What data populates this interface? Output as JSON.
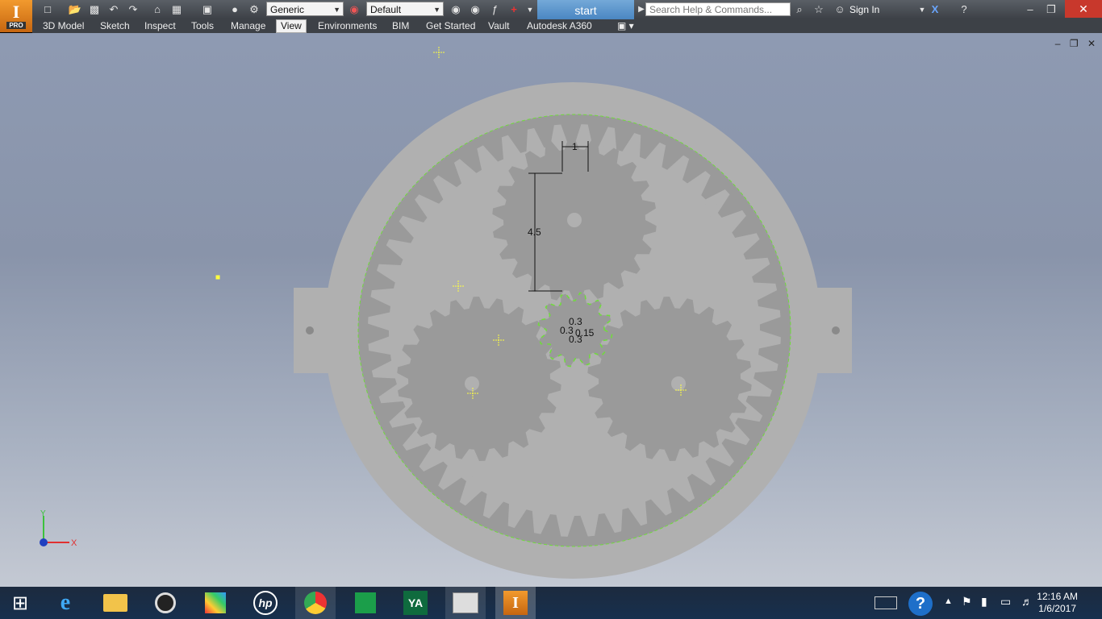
{
  "app": {
    "logo_text": "I",
    "logo_badge": "PRO",
    "document_title": "start"
  },
  "quick_access": {
    "material_value": "Generic",
    "appearance_value": "Default",
    "search_placeholder": "Search Help & Commands...",
    "sign_in_label": "Sign In"
  },
  "ribbon": {
    "tabs": [
      {
        "label": "3D Model"
      },
      {
        "label": "Sketch"
      },
      {
        "label": "Inspect"
      },
      {
        "label": "Tools"
      },
      {
        "label": "Manage"
      },
      {
        "label": "View",
        "active": true
      },
      {
        "label": "Environments"
      },
      {
        "label": "BIM"
      },
      {
        "label": "Get Started"
      },
      {
        "label": "Vault"
      },
      {
        "label": "Autodesk A360"
      }
    ]
  },
  "sketch": {
    "dimensions": {
      "top_width": "1",
      "height": "4.5",
      "d1": "0.3",
      "d2": "0.3",
      "d3": "0.15",
      "d4": "0.3"
    },
    "axes": {
      "y_label": "Y",
      "x_label": "X"
    }
  },
  "taskbar": {
    "time": "12:16 AM",
    "date": "1/6/2017"
  },
  "colors": {
    "accent": "#f29a2e",
    "viewport_top": "#8e9ab2",
    "gear": "#9a9a9a",
    "housing": "#b0b0b0",
    "constraint": "#6fdc3a",
    "construction": "#ffff40"
  }
}
